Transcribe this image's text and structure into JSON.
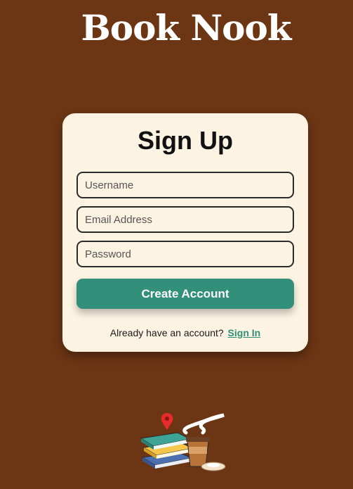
{
  "app": {
    "brand_title": "Book Nook"
  },
  "signup_card": {
    "title": "Sign Up",
    "username_placeholder": "Username",
    "email_placeholder": "Email Address",
    "password_placeholder": "Password",
    "create_account_label": "Create Account",
    "signin_prompt": "Already have an account?",
    "signin_link_label": "Sign In"
  },
  "colors": {
    "background": "#6c3514",
    "card": "#fdf3e3",
    "accent": "#328f79"
  },
  "illustration": {
    "icons": [
      "book-stack-icon",
      "coffee-cup-icon",
      "map-pin-icon",
      "steam-icon",
      "saucer-icon"
    ]
  }
}
